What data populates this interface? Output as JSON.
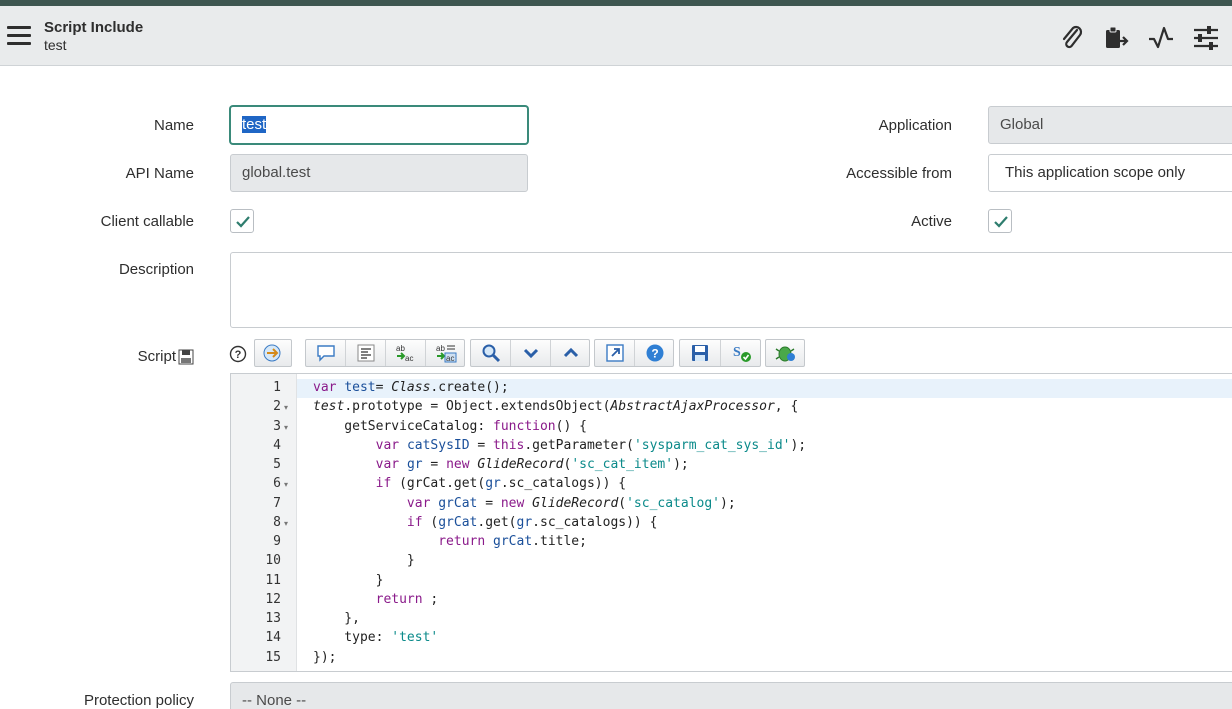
{
  "header": {
    "title": "Script Include",
    "subtitle": "test",
    "icons": [
      "paperclip-icon",
      "clipboard-export-icon",
      "activity-icon",
      "settings-sliders-icon"
    ]
  },
  "form": {
    "name": {
      "label": "Name",
      "value": "test"
    },
    "api_name": {
      "label": "API Name",
      "value": "global.test"
    },
    "client_callable": {
      "label": "Client callable",
      "checked": true
    },
    "description": {
      "label": "Description",
      "value": ""
    },
    "script": {
      "label": "Script"
    },
    "application": {
      "label": "Application",
      "value": "Global"
    },
    "accessible_from": {
      "label": "Accessible from",
      "value": "This application scope only"
    },
    "active": {
      "label": "Active",
      "checked": true
    },
    "protection_policy": {
      "label": "Protection policy",
      "value": "-- None --"
    }
  },
  "editor": {
    "line_numbers": [
      "1",
      "2",
      "3",
      "4",
      "5",
      "6",
      "7",
      "8",
      "9",
      "10",
      "11",
      "12",
      "13",
      "14",
      "15"
    ],
    "folds": [
      2,
      3,
      6,
      8
    ],
    "lines": [
      [
        [
          "kw",
          "var "
        ],
        [
          "vr",
          "test"
        ],
        [
          "",
          "= "
        ],
        [
          "it",
          "Class"
        ],
        [
          "",
          ".create();"
        ]
      ],
      [
        [
          "it",
          "test"
        ],
        [
          "",
          ".prototype = Object.extendsObject("
        ],
        [
          "it",
          "AbstractAjaxProcessor"
        ],
        [
          "",
          ", {"
        ]
      ],
      [
        [
          "",
          "    getServiceCatalog: "
        ],
        [
          "kw",
          "function"
        ],
        [
          "",
          "() {"
        ]
      ],
      [
        [
          "",
          "        "
        ],
        [
          "kw",
          "var "
        ],
        [
          "vr",
          "catSysID"
        ],
        [
          "",
          "",
          " = "
        ],
        [
          "kw",
          "this"
        ],
        [
          "",
          ".getParameter("
        ],
        [
          "st",
          "'sysparm_cat_sys_id'"
        ],
        [
          "",
          ");"
        ]
      ],
      [
        [
          "",
          "        "
        ],
        [
          "kw",
          "var "
        ],
        [
          "vr",
          "gr"
        ],
        [
          "",
          "",
          " = "
        ],
        [
          "kw",
          "new "
        ],
        [
          "it",
          "GlideRecord"
        ],
        [
          "",
          "("
        ],
        [
          "st",
          "'sc_cat_item'"
        ],
        [
          "",
          ");"
        ]
      ],
      [
        [
          "",
          "        "
        ],
        [
          "kw",
          "if "
        ],
        [
          "",
          "(grCat.get("
        ],
        [
          "vr",
          "gr"
        ],
        [
          "",
          ".sc_catalogs)) {"
        ]
      ],
      [
        [
          "",
          "            "
        ],
        [
          "kw",
          "var "
        ],
        [
          "vr",
          "grCat"
        ],
        [
          "",
          "",
          " = "
        ],
        [
          "kw",
          "new "
        ],
        [
          "it",
          "GlideRecord"
        ],
        [
          "",
          "("
        ],
        [
          "st",
          "'sc_catalog'"
        ],
        [
          "",
          ");"
        ]
      ],
      [
        [
          "",
          "            "
        ],
        [
          "kw",
          "if "
        ],
        [
          "",
          "("
        ],
        [
          "vr",
          "grCat"
        ],
        [
          "",
          ".get("
        ],
        [
          "vr",
          "gr"
        ],
        [
          "",
          ".sc_catalogs)) {"
        ]
      ],
      [
        [
          "",
          "                "
        ],
        [
          "kw",
          "return "
        ],
        [
          "vr",
          "grCat"
        ],
        [
          "",
          ".title;"
        ]
      ],
      [
        [
          "",
          "            }"
        ]
      ],
      [
        [
          "",
          "        }"
        ]
      ],
      [
        [
          "",
          "        "
        ],
        [
          "kw",
          "return "
        ],
        [
          "",
          ";"
        ]
      ],
      [
        [
          "",
          "    },"
        ]
      ],
      [
        [
          "",
          "    type: "
        ],
        [
          "st",
          "'test'"
        ]
      ],
      [
        [
          "",
          "});"
        ]
      ]
    ]
  },
  "toolbar": {
    "buttons": [
      "help-icon",
      "script-tree-icon",
      "comment-icon",
      "format-icon",
      "replace-icon",
      "replace-all-icon",
      "search-icon",
      "find-next-icon",
      "find-previous-icon",
      "fullscreen-icon",
      "help-circle-icon",
      "save-icon",
      "syntax-check-icon",
      "debug-icon"
    ]
  },
  "colors": {
    "topstripe": "#3e5650",
    "focus": "#3a8a7a",
    "check": "#2e7d6e"
  }
}
